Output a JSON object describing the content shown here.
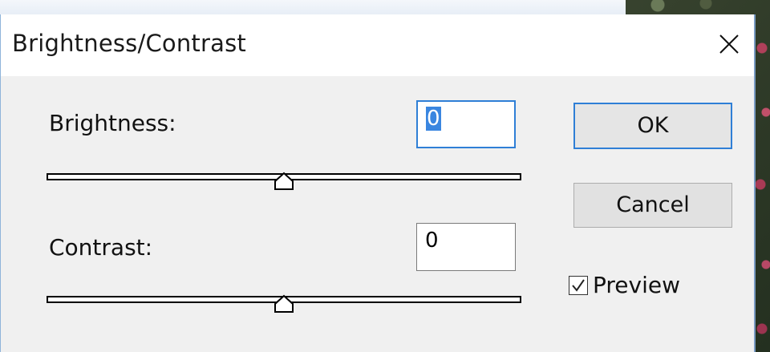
{
  "dialog": {
    "title": "Brightness/Contrast",
    "close_icon": "close-icon"
  },
  "brightness": {
    "label": "Brightness:",
    "value": "0",
    "slider_level": 0.5
  },
  "contrast": {
    "label": "Contrast:",
    "value": "0",
    "slider_level": 0.5
  },
  "buttons": {
    "ok": "OK",
    "cancel": "Cancel"
  },
  "preview": {
    "label": "Preview",
    "checked": true
  },
  "colors": {
    "accent": "#2f7fd6",
    "dialog_bg": "#f0f0f0",
    "title_bg": "#ffffff"
  }
}
